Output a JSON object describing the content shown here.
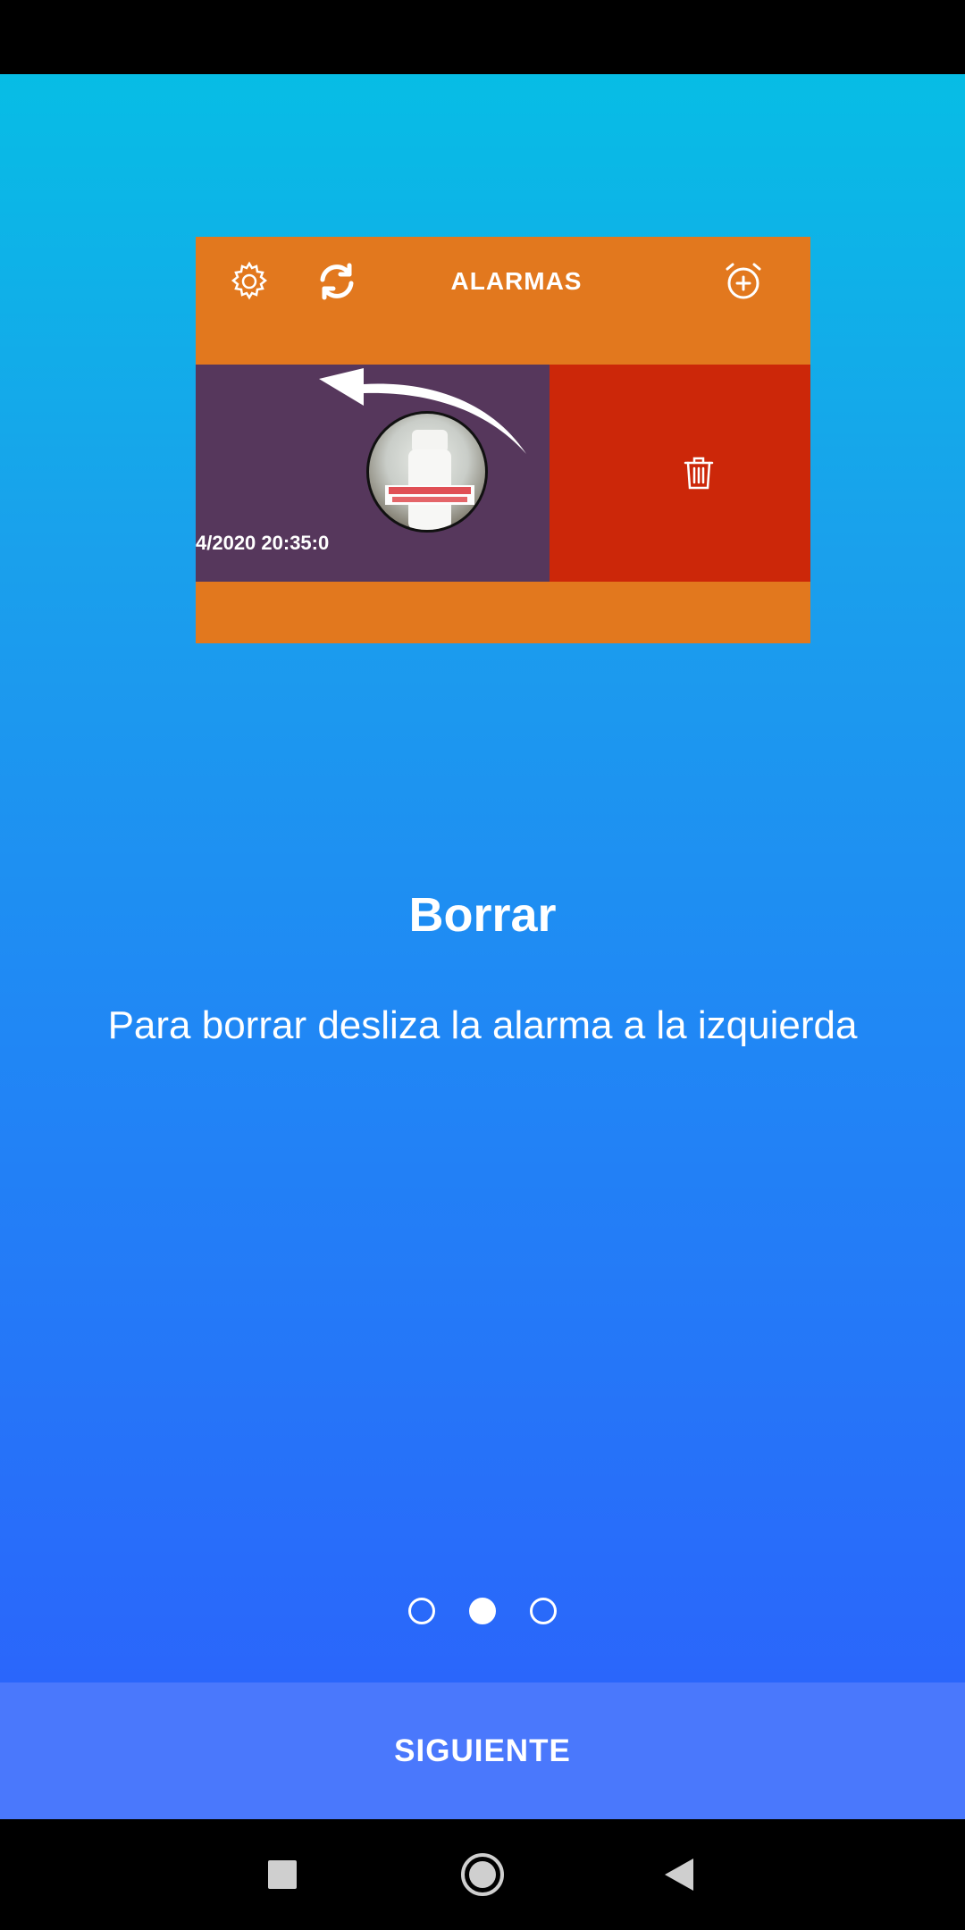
{
  "illustration": {
    "header_title": "ALARMAS",
    "alarm_date": "4/2020 20:35:0",
    "icons": [
      "gear-icon",
      "refresh-icon",
      "alarm-add-icon",
      "trash-icon",
      "swipe-left-arrow-icon"
    ],
    "colors": {
      "header": "#e2781e",
      "alarm_item": "#56375c",
      "delete_area": "#cc2709"
    }
  },
  "slide": {
    "title": "Borrar",
    "description": "Para borrar desliza la alarma a la izquierda"
  },
  "pager": {
    "total": 3,
    "active_index": 1
  },
  "next_button": {
    "label": "SIGUIENTE"
  },
  "nav_bar": {
    "icons": [
      "recents-square-icon",
      "home-circle-icon",
      "back-triangle-icon"
    ]
  }
}
